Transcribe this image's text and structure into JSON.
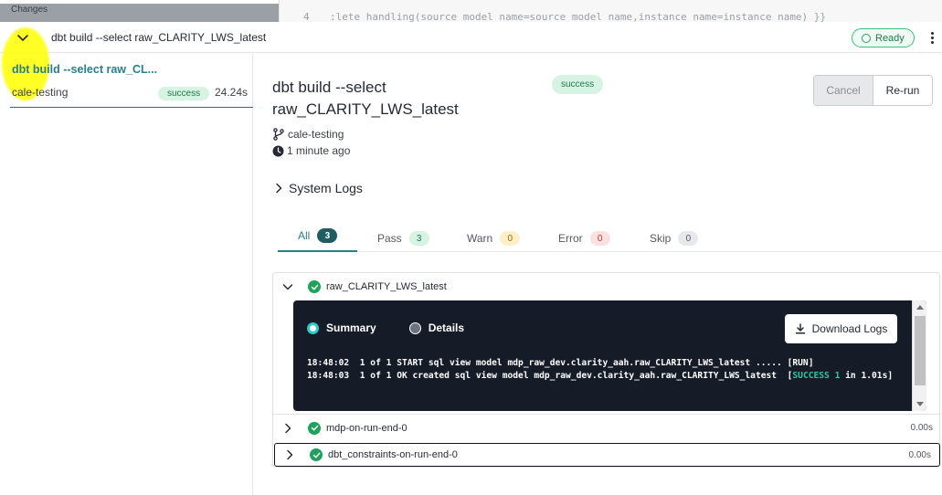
{
  "top_strip": {
    "changes_label": "Changes",
    "line_number": "4",
    "code_line": ":lete_handling(source_model_name=source_model_name,instance_name=instance_name) }}"
  },
  "header": {
    "title": "dbt build --select raw_CLARITY_LWS_latest",
    "status": "Ready",
    "icons": [
      "chevron-down-icon",
      "kebab-menu-icon",
      "circle-icon"
    ]
  },
  "sidebar": {
    "run": {
      "title": "dbt build --select raw_CL...",
      "branch": "cale-testing",
      "status": "success",
      "duration": "24.24s"
    }
  },
  "run": {
    "title": "dbt build --select raw_CLARITY_LWS_latest",
    "status": "success",
    "branch": "cale-testing",
    "time_ago": "1 minute ago",
    "cancel_label": "Cancel",
    "rerun_label": "Re-run",
    "system_logs_label": "System Logs"
  },
  "tabs": [
    {
      "label": "All",
      "count": "3"
    },
    {
      "label": "Pass",
      "count": "3"
    },
    {
      "label": "Warn",
      "count": "0"
    },
    {
      "label": "Error",
      "count": "0"
    },
    {
      "label": "Skip",
      "count": "0"
    }
  ],
  "steps": [
    {
      "name": "raw_CLARITY_LWS_latest",
      "duration": ""
    },
    {
      "name": "mdp-on-run-end-0",
      "duration": "0.00s"
    },
    {
      "name": "dbt_constraints-on-run-end-0",
      "duration": "0.00s"
    }
  ],
  "log_panel": {
    "summary_label": "Summary",
    "details_label": "Details",
    "download_label": "Download Logs",
    "line1": "18:48:02  1 of 1 START sql view model mdp_raw_dev.clarity_aah.raw_CLARITY_LWS_latest ..... [RUN]",
    "line2_prefix": "18:48:03  1 of 1 OK created sql view model mdp_raw_dev.clarity_aah.raw_CLARITY_LWS_latest  [",
    "line2_success": "SUCCESS 1",
    "line2_suffix": " in 1.01s]"
  },
  "colors": {
    "accent": "#2b7d87",
    "success": "#1fa35c",
    "log_bg": "#161b28",
    "highlight": "#ffff00"
  }
}
